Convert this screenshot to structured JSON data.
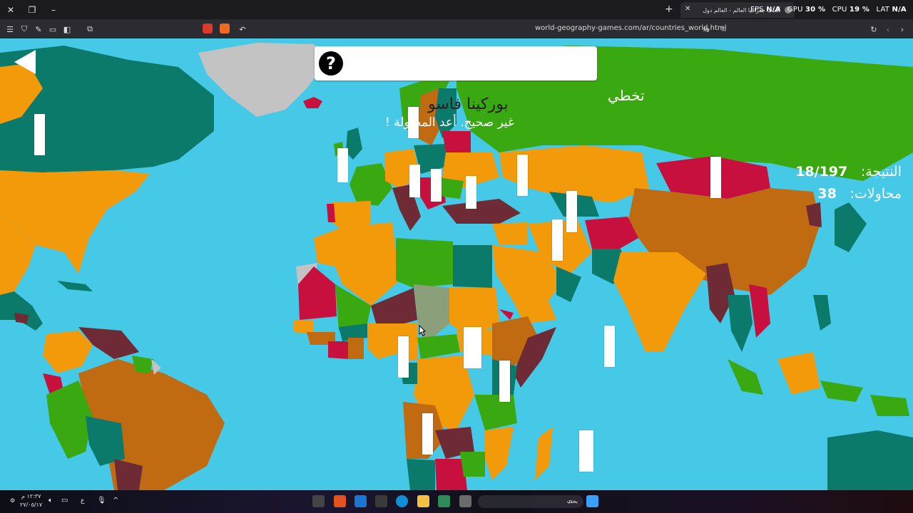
{
  "browser": {
    "tab_title": "ألعاب جغرافيا العالم - العالم دول",
    "url": "world-geography-games.com/ar/countries_world.html",
    "perf": {
      "fps_label": "FPS",
      "fps_value": "N/A",
      "gpu_label": "GPU",
      "gpu_value": "30 %",
      "cpu_label": "CPU",
      "cpu_value": "19 %",
      "lat_label": "LAT",
      "lat_value": "N/A"
    }
  },
  "game": {
    "skip_label": "تخطي",
    "target_country": "بوركينا فاسو",
    "feedback": "غير صحيح. أعد المحاولة !",
    "score_label": "النتيجة:",
    "score_value": "18/197",
    "attempts_label": "محاولات:",
    "attempts_value": "38",
    "colors": {
      "ocean": "#45c9e6",
      "teal": "#0b7a6b",
      "orange": "#f39a0a",
      "brown": "#c06a12",
      "green": "#3aa810",
      "crimson": "#c8103e",
      "maroon": "#6e2b35",
      "grey": "#c3c3c3"
    }
  },
  "taskbar": {
    "time": "١٢:٣٧ م",
    "date": "٢٧/٠٥/١٧",
    "lang": "ع",
    "search_placeholder": "بحث"
  }
}
